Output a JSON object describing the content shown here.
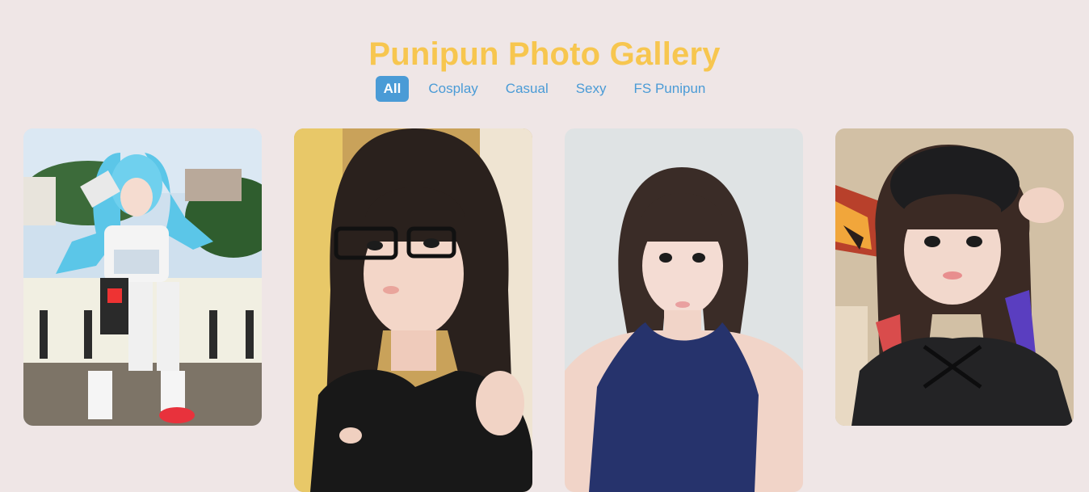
{
  "header": {
    "title": "Punipun Photo Gallery"
  },
  "filters": [
    {
      "label": "All",
      "active": true
    },
    {
      "label": "Cosplay",
      "active": false
    },
    {
      "label": "Casual",
      "active": false
    },
    {
      "label": "Sexy",
      "active": false
    },
    {
      "label": "FS Punipun",
      "active": false
    }
  ],
  "gallery": {
    "photos": [
      {
        "subject": "cosplay-blue-hair-outdoor"
      },
      {
        "subject": "glasses-black-top"
      },
      {
        "subject": "navy-top-bob-hair"
      },
      {
        "subject": "beanie-selfie"
      }
    ]
  },
  "colors": {
    "background": "#efe6e6",
    "title": "#f7c64f",
    "accent": "#4a9bd6"
  }
}
